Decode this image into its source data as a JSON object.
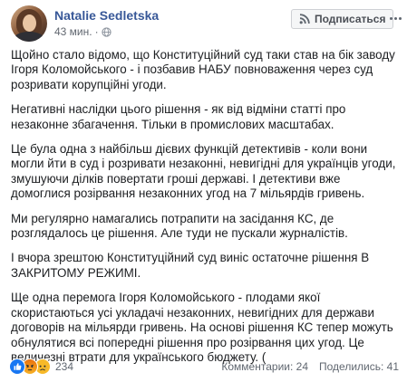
{
  "post": {
    "author": "Natalie Sedletska",
    "time": "43 мин.",
    "privacy_icon": "globe-icon",
    "follow_label": "Подписаться",
    "more_icon": "more-dots-icon",
    "paragraphs": [
      "Щойно стало відомо, що Конституційний суд таки став на бік заводу Ігоря Коломойського - і позбавив НАБУ повноваження через суд розривати корупційні угоди.",
      "Негативні наслідки цього рішення - як від відміни статті про незаконне збагачення. Тільки в промислових масштабах.",
      "Це була одна з найбільш дієвих функцій детективів - коли вони могли йти в суд і розривати незаконні, невигідні для українців угоди, змушуючи ділків повертати гроші державі. І детективи вже домоглися розірвання незаконних угод на 7 мільярдів гривень.",
      "Ми регулярно намагались потрапити на засідання КС, де розглядалось це рішення. Але туди не пускали журналістів.",
      "І вчора зрештою Конституційний суд виніс остаточне рішення В ЗАКРИТОМУ РЕЖИМІ.",
      "Ще одна перемога Ігоря Коломойського - плодами якої скористаються усі укладачі незаконних, невигідних для держави договорів на мільярди гривень. На основі рішення КС тепер можуть обнулятися всі попередні рішення про розірвання цих угод. Це величезні втрати для українського бюджету. ("
    ]
  },
  "footer": {
    "reactions": [
      "like-icon",
      "angry-icon",
      "sad-icon"
    ],
    "reaction_count": "234",
    "comments": "Комментарии: 24",
    "shares": "Поделились: 41"
  },
  "colors": {
    "author": "#385898",
    "meta": "#616770",
    "text": "#1c1e21",
    "like": "#1877f2",
    "button_bg": "#f5f6f7"
  }
}
